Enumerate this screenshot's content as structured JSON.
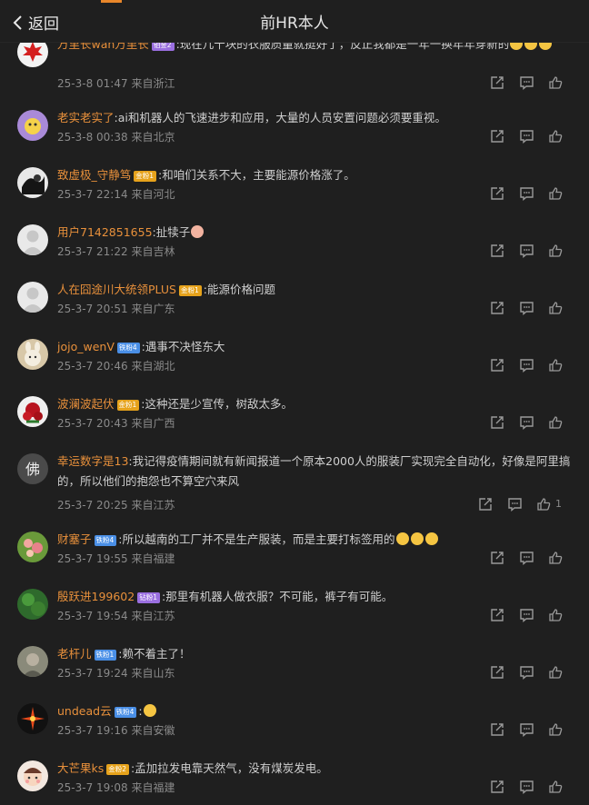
{
  "header": {
    "back_label": "返回",
    "title": "前HR本人"
  },
  "colors": {
    "accent": "#e8862a",
    "username": "#e8903b",
    "badge_gold": "#e6a21b",
    "badge_blue": "#4a8fe6",
    "badge_purple": "#9a6fe0"
  },
  "comments": [
    {
      "user": "万里长wan万里长",
      "badge": "铂金2",
      "text": ":现在几十块的衣服质量就挺好了，反正我都是一年一换年年穿新的",
      "emojis": 3,
      "date": "25-3-8 01:47",
      "loc": "来自浙江",
      "likes": "",
      "avatar": "leaf"
    },
    {
      "user": "老实老实了",
      "badge": "",
      "text": ":ai和机器人的飞速进步和应用，大量的人员安置问题必须要重视。",
      "emojis": 0,
      "date": "25-3-8 00:38",
      "loc": "来自北京",
      "likes": "",
      "avatar": "purple"
    },
    {
      "user": "致虚极_守静笃",
      "badge": "金粉1",
      "text": ":和咱们关系不大，主要能源价格涨了。",
      "emojis": 0,
      "date": "25-3-7 22:14",
      "loc": "来自河北",
      "likes": "",
      "avatar": "ink"
    },
    {
      "user": "用户7142851655",
      "badge": "",
      "text": ":扯犊子",
      "emojis": 1,
      "date": "25-3-7 21:22",
      "loc": "来自吉林",
      "likes": "",
      "avatar": "default"
    },
    {
      "user": "人在囧途川大统领PLUS",
      "badge": "金粉1",
      "text": ":能源价格问题",
      "emojis": 0,
      "date": "25-3-7 20:51",
      "loc": "来自广东",
      "likes": "",
      "avatar": "default"
    },
    {
      "user": "jojo_wenV",
      "badge": "铁粉4",
      "text": ":遇事不决怪东大",
      "emojis": 0,
      "date": "25-3-7 20:46",
      "loc": "来自湖北",
      "likes": "",
      "avatar": "bunny"
    },
    {
      "user": "波澜波起伏",
      "badge": "金粉1",
      "text": ":这种还是少宣传，树敌太多。",
      "emojis": 0,
      "date": "25-3-7 20:43",
      "loc": "来自广西",
      "likes": "",
      "avatar": "rose"
    },
    {
      "user": "幸运数字是13",
      "badge": "",
      "text": ":我记得疫情期间就有新闻报道一个原本2000人的服装厂实现完全自动化，好像是阿里搞的，所以他们的抱怨也不算空穴来风",
      "emojis": 0,
      "date": "25-3-7 20:25",
      "loc": "来自江苏",
      "likes": "1",
      "avatar": "fo"
    },
    {
      "user": "财塞子",
      "badge": "铁粉4",
      "text": ":所以越南的工厂并不是生产服装，而是主要打标签用的",
      "emojis": 3,
      "date": "25-3-7 19:55",
      "loc": "来自福建",
      "likes": "",
      "avatar": "flower"
    },
    {
      "user": "殷跃进199602",
      "badge": "钻粉1",
      "text": ":那里有机器人做衣服？不可能，裤子有可能。",
      "emojis": 0,
      "date": "25-3-7 19:54",
      "loc": "来自江苏",
      "likes": "",
      "avatar": "green"
    },
    {
      "user": "老杆儿",
      "badge": "铁粉1",
      "text": ":赖不着主了！",
      "emojis": 0,
      "date": "25-3-7 19:24",
      "loc": "来自山东",
      "likes": "",
      "avatar": "old"
    },
    {
      "user": "undead云",
      "badge": "铁粉4",
      "text": ":",
      "emojis": 1,
      "date": "25-3-7 19:16",
      "loc": "来自安徽",
      "likes": "",
      "avatar": "spark"
    },
    {
      "user": "大芒果ks",
      "badge": "金粉2",
      "text": ":孟加拉发电靠天然气，没有煤炭发电。",
      "emojis": 0,
      "date": "25-3-7 19:08",
      "loc": "来自福建",
      "likes": "",
      "avatar": "cartoon"
    }
  ]
}
